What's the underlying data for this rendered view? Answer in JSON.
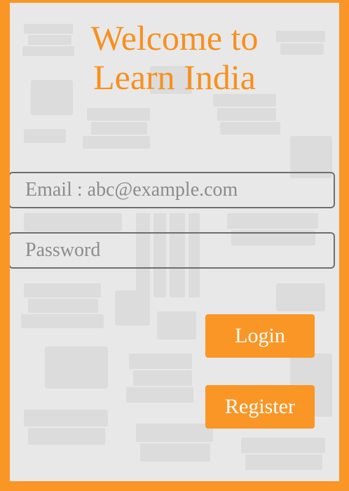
{
  "title": {
    "line1": "Welcome to",
    "line2": "Learn India"
  },
  "form": {
    "email_placeholder": "Email : abc@example.com",
    "password_placeholder": "Password",
    "login_label": "Login",
    "register_label": "Register"
  },
  "colors": {
    "accent": "#fa9626",
    "title": "#f7901e",
    "background": "#e8e8e8"
  },
  "background_pattern": "books-icon"
}
